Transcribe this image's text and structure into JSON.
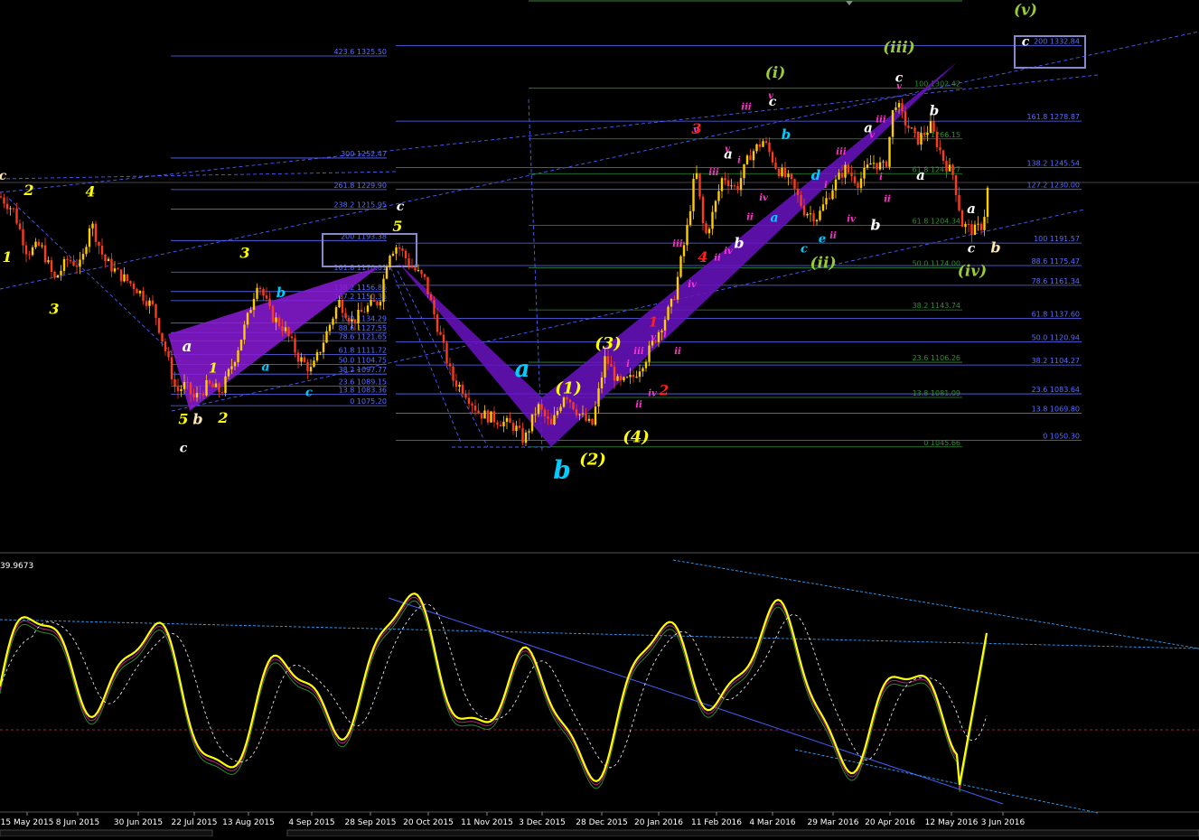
{
  "chart_data": {
    "type": "candlestick",
    "panes": [
      {
        "name": "price",
        "ylim": [
          1000,
          1350
        ],
        "x_range": [
          0,
          1100
        ]
      },
      {
        "name": "oscillator",
        "top_value_label": "39.9673",
        "ylim": [
          0,
          100
        ]
      }
    ],
    "date_ticks": [
      {
        "x": 30,
        "label": "15 May 2015"
      },
      {
        "x": 86,
        "label": "8 Jun 2015"
      },
      {
        "x": 153,
        "label": "30 Jun 2015"
      },
      {
        "x": 215,
        "label": "22 Jul 2015"
      },
      {
        "x": 275,
        "label": "13 Aug 2015"
      },
      {
        "x": 345,
        "label": "4 Sep 2015"
      },
      {
        "x": 410,
        "label": "28 Sep 2015"
      },
      {
        "x": 474,
        "label": "20 Oct 2015"
      },
      {
        "x": 539,
        "label": "11 Nov 2015"
      },
      {
        "x": 600,
        "label": "3 Dec 2015"
      },
      {
        "x": 666,
        "label": "28 Dec 2015"
      },
      {
        "x": 729,
        "label": "20 Jan 2016"
      },
      {
        "x": 793,
        "label": "11 Feb 2016"
      },
      {
        "x": 855,
        "label": "4 Mar 2016"
      },
      {
        "x": 922,
        "label": "29 Mar 2016"
      },
      {
        "x": 985,
        "label": "20 Apr 2016"
      },
      {
        "x": 1053,
        "label": "12 May 2016"
      },
      {
        "x": 1110,
        "label": "3 Jun 2016"
      }
    ],
    "fib_left": [
      {
        "label": "423.6 1325.50",
        "price": 1325.5
      },
      {
        "label": "300 1252.47",
        "price": 1252.47
      },
      {
        "label": "261.8 1229.90",
        "price": 1229.9
      },
      {
        "label": "238.2 1215.95",
        "price": 1215.95
      },
      {
        "label": "200 1193.38",
        "price": 1193.38
      },
      {
        "label": "161.8 1170.81",
        "price": 1170.81
      },
      {
        "label": "138.2 1156.86",
        "price": 1156.86
      },
      {
        "label": "127.2 1150.36",
        "price": 1150.36
      },
      {
        "label": "100 1134.29",
        "price": 1134.29
      },
      {
        "label": "88.6 1127.55",
        "price": 1127.55
      },
      {
        "label": "78.6 1121.65",
        "price": 1121.65
      },
      {
        "label": "61.8 1111.72",
        "price": 1111.72
      },
      {
        "label": "50.0 1104.75",
        "price": 1104.75
      },
      {
        "label": "38.2 1097.77",
        "price": 1097.77
      },
      {
        "label": "23.6 1089.15",
        "price": 1089.15
      },
      {
        "label": "13.8 1083.36",
        "price": 1083.36
      },
      {
        "label": "0 1075.20",
        "price": 1075.2
      }
    ],
    "fib_right": [
      {
        "label": "200 1332.84",
        "price": 1332.84
      },
      {
        "label": "161.8 1278.87",
        "price": 1278.87
      },
      {
        "label": "138.2 1245.54",
        "price": 1245.54
      },
      {
        "label": "127.2 1230.00",
        "price": 1230.0
      },
      {
        "label": "100 1191.57",
        "price": 1191.57
      },
      {
        "label": "88.6 1175.47",
        "price": 1175.47
      },
      {
        "label": "78.6 1161.34",
        "price": 1161.34
      },
      {
        "label": "61.8 1137.60",
        "price": 1137.6
      },
      {
        "label": "50.0 1120.94",
        "price": 1120.94
      },
      {
        "label": "38.2 1104.27",
        "price": 1104.27
      },
      {
        "label": "23.6 1083.64",
        "price": 1083.64
      },
      {
        "label": "13.8 1069.80",
        "price": 1069.8
      },
      {
        "label": "0 1050.30",
        "price": 1050.3
      }
    ],
    "fib_green": [
      {
        "label": "100 1302.42",
        "price": 1302.42
      },
      {
        "label": "78.6 1266.15",
        "price": 1266.15
      },
      {
        "label": "61.8 1241.27",
        "price": 1241.27
      },
      {
        "label": "61.8 1204.34",
        "price": 1204.34
      },
      {
        "label": "50.0 1174.00",
        "price": 1174.0
      },
      {
        "label": "38.2 1143.74",
        "price": 1143.74
      },
      {
        "label": "23.6 1106.26",
        "price": 1106.26
      },
      {
        "label": "13.8 1081.09",
        "price": 1081.09
      },
      {
        "label": "0 1045.66",
        "price": 1045.66
      }
    ],
    "wave_labels": [
      {
        "t": "c",
        "x": 3,
        "p": 1237,
        "c": "#ffe6b0",
        "s": 14
      },
      {
        "t": "2",
        "x": 32,
        "p": 1226,
        "c": "#ffff00",
        "s": 16
      },
      {
        "t": "1",
        "x": 8,
        "p": 1178,
        "c": "#ffff00",
        "s": 16
      },
      {
        "t": "3",
        "x": 60,
        "p": 1141,
        "c": "#ffff00",
        "s": 16
      },
      {
        "t": "4",
        "x": 100,
        "p": 1225,
        "c": "#ffff00",
        "s": 16
      },
      {
        "t": "a",
        "x": 207,
        "p": 1114,
        "c": "#ffffff",
        "s": 17
      },
      {
        "t": "1",
        "x": 236,
        "p": 1099,
        "c": "#ffff00",
        "s": 15
      },
      {
        "t": "5",
        "x": 203,
        "p": 1062,
        "c": "#ffff00",
        "s": 16
      },
      {
        "t": "b",
        "x": 219,
        "p": 1062,
        "c": "#ffe6b0",
        "s": 16
      },
      {
        "t": "2",
        "x": 247,
        "p": 1063,
        "c": "#ffff00",
        "s": 16
      },
      {
        "t": "c",
        "x": 203,
        "p": 1042,
        "c": "#ffffff",
        "s": 14
      },
      {
        "t": "3",
        "x": 271,
        "p": 1181,
        "c": "#ffff00",
        "s": 16
      },
      {
        "t": "b",
        "x": 311,
        "p": 1153,
        "c": "#00ccff",
        "s": 15
      },
      {
        "t": "a",
        "x": 294,
        "p": 1100,
        "c": "#00ccff",
        "s": 14
      },
      {
        "t": "c",
        "x": 342,
        "p": 1082,
        "c": "#00ccff",
        "s": 13
      },
      {
        "t": "c",
        "x": 443,
        "p": 1215,
        "c": "#ffffff",
        "s": 14
      },
      {
        "t": "5",
        "x": 440,
        "p": 1200,
        "c": "#ffff00",
        "s": 16
      },
      {
        "t": "a",
        "x": 578,
        "p": 1096,
        "c": "#00ccff",
        "s": 26
      },
      {
        "t": "b",
        "x": 622,
        "p": 1023,
        "c": "#00ccff",
        "s": 28
      },
      {
        "t": "(1)",
        "x": 629,
        "p": 1084,
        "c": "#ffff00",
        "s": 18
      },
      {
        "t": "(2)",
        "x": 656,
        "p": 1033,
        "c": "#ffff00",
        "s": 18
      },
      {
        "t": "(3)",
        "x": 673,
        "p": 1116,
        "c": "#ffff00",
        "s": 18
      },
      {
        "t": "(4)",
        "x": 704,
        "p": 1049,
        "c": "#ffff00",
        "s": 18
      },
      {
        "t": "3",
        "x": 771,
        "p": 1270,
        "c": "#ff2020",
        "s": 16
      },
      {
        "t": "4",
        "x": 778,
        "p": 1178,
        "c": "#ff2020",
        "s": 16
      },
      {
        "t": "1",
        "x": 723,
        "p": 1132,
        "c": "#ff2020",
        "s": 15
      },
      {
        "t": "2",
        "x": 735,
        "p": 1083,
        "c": "#ff2020",
        "s": 15
      },
      {
        "t": "a",
        "x": 806,
        "p": 1252,
        "c": "#ffffff",
        "s": 15
      },
      {
        "t": "b",
        "x": 818,
        "p": 1188,
        "c": "#ffffff",
        "s": 16
      },
      {
        "t": "(i)",
        "x": 858,
        "p": 1310,
        "c": "#99cc33",
        "s": 17
      },
      {
        "t": "c",
        "x": 855,
        "p": 1290,
        "c": "#ffffff",
        "s": 14
      },
      {
        "t": "b",
        "x": 870,
        "p": 1266,
        "c": "#00ccff",
        "s": 15
      },
      {
        "t": "a",
        "x": 857,
        "p": 1207,
        "c": "#00ccff",
        "s": 14
      },
      {
        "t": "d",
        "x": 903,
        "p": 1237,
        "c": "#00ccff",
        "s": 15
      },
      {
        "t": "c",
        "x": 890,
        "p": 1185,
        "c": "#00ccff",
        "s": 13
      },
      {
        "t": "e",
        "x": 910,
        "p": 1192,
        "c": "#00ccff",
        "s": 13
      },
      {
        "t": "(ii)",
        "x": 911,
        "p": 1174,
        "c": "#99cc33",
        "s": 17
      },
      {
        "t": "a",
        "x": 961,
        "p": 1271,
        "c": "#ffffff",
        "s": 15
      },
      {
        "t": "b",
        "x": 969,
        "p": 1201,
        "c": "#ffffff",
        "s": 16
      },
      {
        "t": "(iii)",
        "x": 995,
        "p": 1328,
        "c": "#99cc33",
        "s": 17
      },
      {
        "t": "c",
        "x": 995,
        "p": 1307,
        "c": "#ffffff",
        "s": 14
      },
      {
        "t": "b",
        "x": 1034,
        "p": 1283,
        "c": "#ffffff",
        "s": 15
      },
      {
        "t": "a",
        "x": 1019,
        "p": 1237,
        "c": "#ffffff",
        "s": 15
      },
      {
        "t": "a",
        "x": 1075,
        "p": 1213,
        "c": "#ffffff",
        "s": 15
      },
      {
        "t": "c",
        "x": 1075,
        "p": 1185,
        "c": "#ffffff",
        "s": 14
      },
      {
        "t": "b",
        "x": 1102,
        "p": 1185,
        "c": "#ffe6b0",
        "s": 16
      },
      {
        "t": "(iv)",
        "x": 1076,
        "p": 1168,
        "c": "#99cc33",
        "s": 17
      },
      {
        "t": "(v)",
        "x": 1135,
        "p": 1355,
        "c": "#99cc33",
        "s": 17
      },
      {
        "t": "c",
        "x": 1135,
        "p": 1333,
        "c": "#ffffff",
        "s": 14
      },
      {
        "t": "iii",
        "x": 750,
        "p": 1189,
        "c": "#ff33cc",
        "s": 10
      },
      {
        "t": "iv",
        "x": 766,
        "p": 1160,
        "c": "#ff33cc",
        "s": 10
      },
      {
        "t": "i",
        "x": 695,
        "p": 1103,
        "c": "#ff33cc",
        "s": 10
      },
      {
        "t": "iii",
        "x": 707,
        "p": 1112,
        "c": "#ff33cc",
        "s": 10
      },
      {
        "t": "v",
        "x": 723,
        "p": 1122,
        "c": "#ff33cc",
        "s": 10
      },
      {
        "t": "i",
        "x": 736,
        "p": 1124,
        "c": "#ff33cc",
        "s": 10
      },
      {
        "t": "ii",
        "x": 750,
        "p": 1112,
        "c": "#ff33cc",
        "s": 10
      },
      {
        "t": "iv",
        "x": 722,
        "p": 1082,
        "c": "#ff33cc",
        "s": 10
      },
      {
        "t": "ii",
        "x": 707,
        "p": 1074,
        "c": "#ff33cc",
        "s": 10
      },
      {
        "t": "iii",
        "x": 790,
        "p": 1240,
        "c": "#ff33cc",
        "s": 10
      },
      {
        "t": "v",
        "x": 805,
        "p": 1257,
        "c": "#ff33cc",
        "s": 10
      },
      {
        "t": "i",
        "x": 818,
        "p": 1249,
        "c": "#ff33cc",
        "s": 10
      },
      {
        "t": "iv",
        "x": 806,
        "p": 1184,
        "c": "#ff33cc",
        "s": 10
      },
      {
        "t": "ii",
        "x": 794,
        "p": 1179,
        "c": "#ff33cc",
        "s": 10
      },
      {
        "t": "ii",
        "x": 830,
        "p": 1208,
        "c": "#ff33cc",
        "s": 10
      },
      {
        "t": "iv",
        "x": 845,
        "p": 1222,
        "c": "#ff33cc",
        "s": 10
      },
      {
        "t": "iii",
        "x": 826,
        "p": 1287,
        "c": "#ff33cc",
        "s": 10
      },
      {
        "t": "v",
        "x": 853,
        "p": 1295,
        "c": "#ff33cc",
        "s": 10
      },
      {
        "t": "v",
        "x": 770,
        "p": 1271,
        "c": "#ff33cc",
        "s": 10
      },
      {
        "t": "iii",
        "x": 931,
        "p": 1255,
        "c": "#ff33cc",
        "s": 10
      },
      {
        "t": "i",
        "x": 914,
        "p": 1231,
        "c": "#ff33cc",
        "s": 10
      },
      {
        "t": "ii",
        "x": 922,
        "p": 1195,
        "c": "#ff33cc",
        "s": 10
      },
      {
        "t": "iv",
        "x": 942,
        "p": 1207,
        "c": "#ff33cc",
        "s": 10
      },
      {
        "t": "ii",
        "x": 982,
        "p": 1221,
        "c": "#ff33cc",
        "s": 10
      },
      {
        "t": "i",
        "x": 975,
        "p": 1237,
        "c": "#ff33cc",
        "s": 10
      },
      {
        "t": "iii",
        "x": 975,
        "p": 1278,
        "c": "#ff33cc",
        "s": 10
      },
      {
        "t": "v",
        "x": 965,
        "p": 1267,
        "c": "#ff33cc",
        "s": 10
      },
      {
        "t": "v",
        "x": 995,
        "p": 1302,
        "c": "#ff33cc",
        "s": 10
      }
    ]
  }
}
